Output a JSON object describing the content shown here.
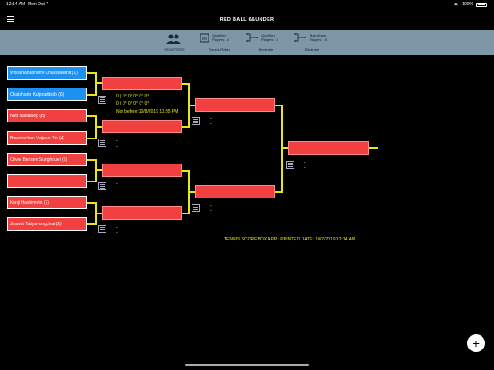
{
  "status": {
    "time": "12:14 AM",
    "date": "Mon Oct 7",
    "battery": "100%"
  },
  "header": {
    "title": "RED BALL 6&UNDER"
  },
  "tabs": [
    {
      "label": "REGISTERS",
      "icon": "people-icon",
      "title": "",
      "sub": ""
    },
    {
      "label": "Round-Robin",
      "icon": "roundrobin-icon",
      "title": "Qualifier",
      "sub": "Players : 4"
    },
    {
      "label": "Eliminate",
      "icon": "bracket-icon",
      "title": "Qualifier",
      "sub": "Players : 8"
    },
    {
      "label": "Eliminate",
      "icon": "bracket-icon",
      "title": "MainDraw",
      "sub": "Players : 4"
    }
  ],
  "players": [
    "Worathanabhumi Chuesawanit (1)",
    "Chatcharin Kulpraditsilp (6)",
    "Nutt Natansep (8)",
    "Boworachan Vaijean Tin (4)",
    "Oliver Bensen  Sunghouei (5)",
    "",
    "Kenji Hashimoto (7)",
    "Jirawat Tatiyavongchai (2)"
  ],
  "match1": {
    "score_line1": "0 | 0° 0° 0° 0° 0°",
    "score_line2": "0 | 0° 0° 0° 0° 0°",
    "not_before": "Not before:10/8/2019 11:35 PM"
  },
  "dash": "-",
  "printed": "TENNIS SCOREBOX APP : PRINTED DATE: 10/7/2019 12:14 AM",
  "fab": "+",
  "colors": {
    "blue": "#1e90f0",
    "red": "#f04040",
    "line": "#e6e61e",
    "tabbar": "#7d97a6"
  }
}
